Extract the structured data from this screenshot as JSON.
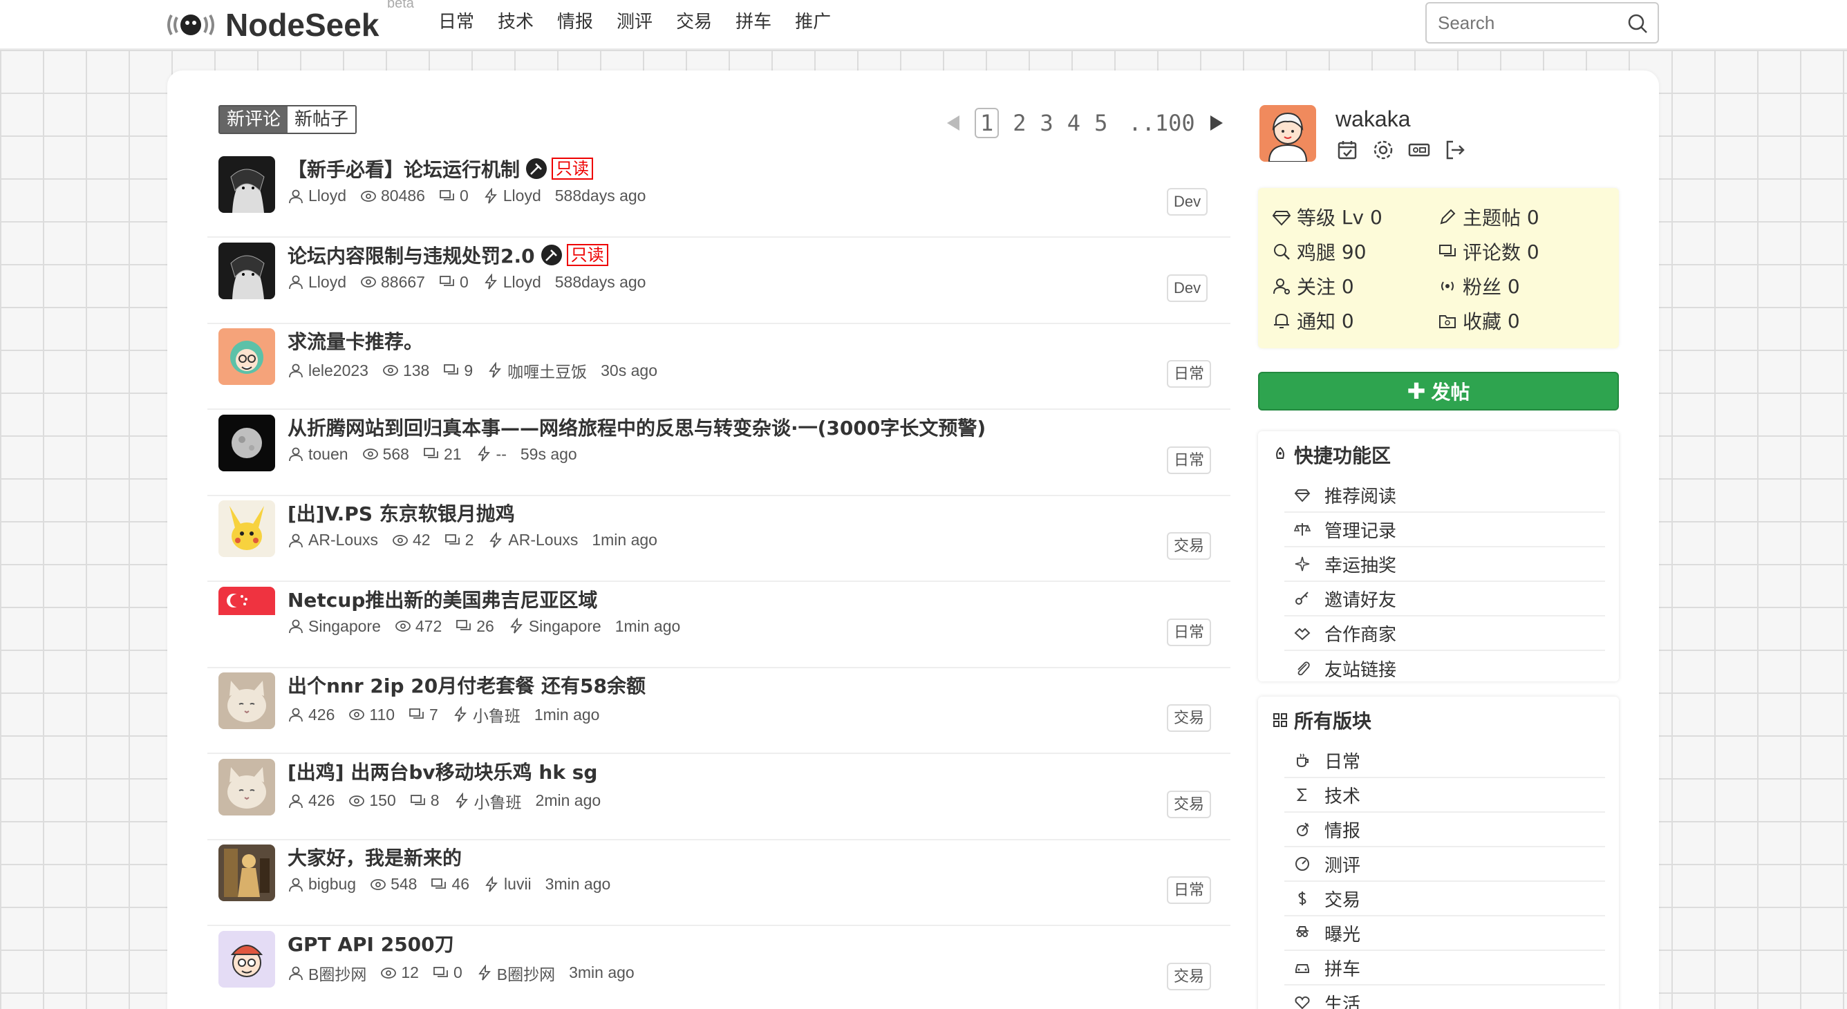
{
  "header": {
    "logo_text": "NodeSeek",
    "logo_beta": "beta",
    "nav": [
      "日常",
      "技术",
      "情报",
      "测评",
      "交易",
      "拼车",
      "推广"
    ],
    "search_placeholder": "Search"
  },
  "tabs": [
    "新评论",
    "新帖子"
  ],
  "pager": {
    "current": "1",
    "pages": [
      "2",
      "3",
      "4",
      "5"
    ],
    "last": "..100"
  },
  "posts": [
    {
      "title": "【新手必看】论坛运行机制",
      "pinned": true,
      "readonly": "只读",
      "author": "Lloyd",
      "views": "80486",
      "comments": "0",
      "last": "Lloyd",
      "time": "588days ago",
      "tag": "Dev",
      "avatar": "anime"
    },
    {
      "title": "论坛内容限制与违规处罚2.0",
      "pinned": true,
      "readonly": "只读",
      "author": "Lloyd",
      "views": "88667",
      "comments": "0",
      "last": "Lloyd",
      "time": "588days ago",
      "tag": "Dev",
      "avatar": "anime"
    },
    {
      "title": "求流量卡推荐。",
      "author": "lele2023",
      "views": "138",
      "comments": "9",
      "last": "咖喱土豆饭",
      "time": "30s ago",
      "tag": "日常",
      "avatar": "girl"
    },
    {
      "title": "从折腾网站到回归真本事——网络旅程中的反思与转变杂谈·一(3000字长文预警)",
      "author": "touen",
      "views": "568",
      "comments": "21",
      "last": "--",
      "time": "59s ago",
      "tag": "日常",
      "avatar": "moon"
    },
    {
      "title": "[出]V.PS 东京软银月抛鸡",
      "author": "AR-Louxs",
      "views": "42",
      "comments": "2",
      "last": "AR-Louxs",
      "time": "1min ago",
      "tag": "交易",
      "avatar": "pikachu"
    },
    {
      "title": "Netcup推出新的美国弗吉尼亚区域",
      "author": "Singapore",
      "views": "472",
      "comments": "26",
      "last": "Singapore",
      "time": "1min ago",
      "tag": "日常",
      "avatar": "flag"
    },
    {
      "title": "出个nnr 2ip 20月付老套餐 还有58余额",
      "author": "426",
      "views": "110",
      "comments": "7",
      "last": "小鲁班",
      "time": "1min ago",
      "tag": "交易",
      "avatar": "cat"
    },
    {
      "title": "[出鸡] 出两台bv移动块乐鸡 hk sg",
      "author": "426",
      "views": "150",
      "comments": "8",
      "last": "小鲁班",
      "time": "2min ago",
      "tag": "交易",
      "avatar": "cat"
    },
    {
      "title": "大家好，我是新来的",
      "author": "bigbug",
      "views": "548",
      "comments": "46",
      "last": "luvii",
      "time": "3min ago",
      "tag": "日常",
      "avatar": "figure"
    },
    {
      "title": "GPT API 2500刀",
      "author": "B圈抄网",
      "views": "12",
      "comments": "0",
      "last": "B圈抄网",
      "time": "3min ago",
      "tag": "交易",
      "avatar": "cartoon"
    }
  ],
  "user": {
    "name": "wakaka",
    "stats": [
      {
        "label": "等级",
        "value": "Lv 0"
      },
      {
        "label": "主题帖",
        "value": "0"
      },
      {
        "label": "鸡腿",
        "value": "90"
      },
      {
        "label": "评论数",
        "value": "0"
      },
      {
        "label": "关注",
        "value": "0"
      },
      {
        "label": "粉丝",
        "value": "0"
      },
      {
        "label": "通知",
        "value": "0"
      },
      {
        "label": "收藏",
        "value": "0"
      }
    ]
  },
  "post_button": "发帖",
  "quick_panel": {
    "title": "快捷功能区",
    "items": [
      "推荐阅读",
      "管理记录",
      "幸运抽奖",
      "邀请好友",
      "合作商家",
      "友站链接"
    ]
  },
  "boards_panel": {
    "title": "所有版块",
    "items": [
      "日常",
      "技术",
      "情报",
      "测评",
      "交易",
      "曝光",
      "拼车",
      "生活"
    ]
  },
  "colors": {
    "post_button": "#2ea44f",
    "stats_bg": "#fdfbd9",
    "readonly": "#e00000",
    "active_tab": "#666666"
  }
}
